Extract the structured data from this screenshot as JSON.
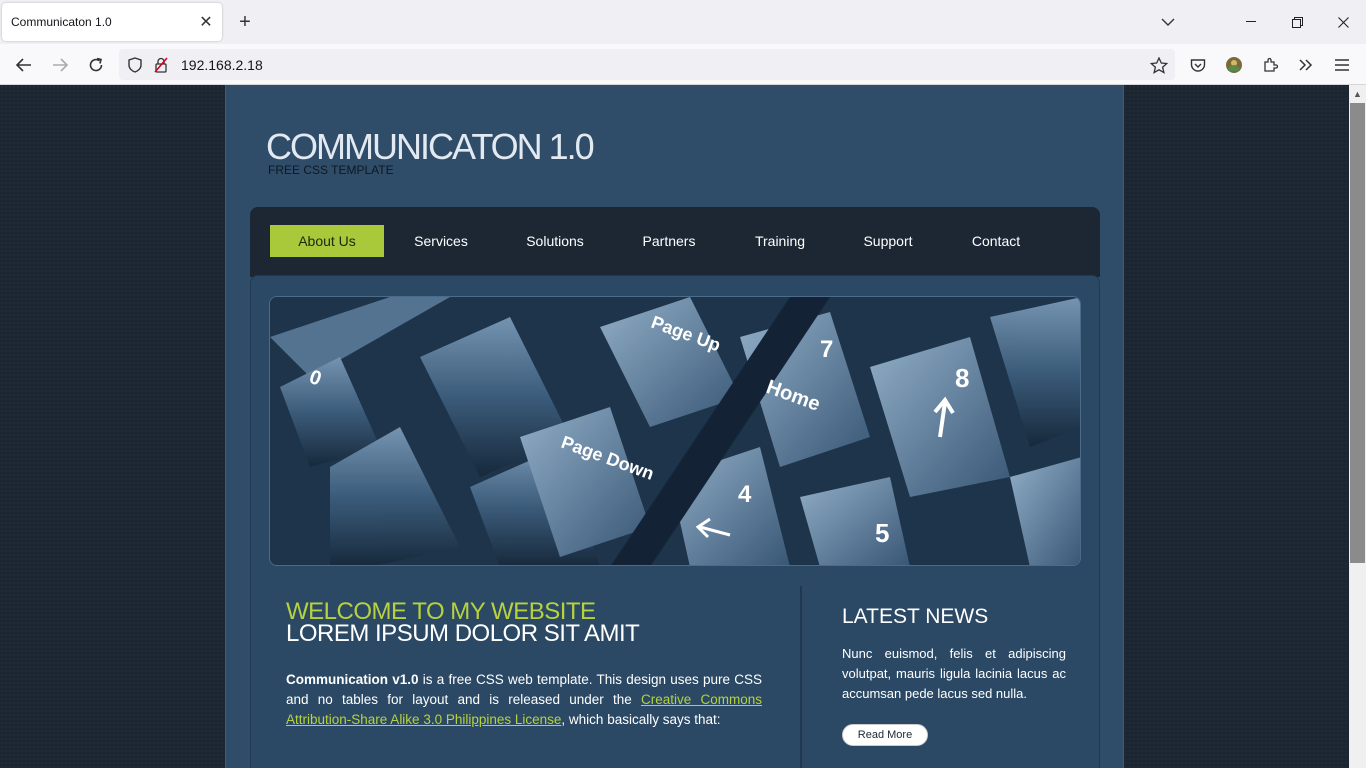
{
  "browser": {
    "tab_title": "Communicaton 1.0",
    "url": "192.168.2.18"
  },
  "site": {
    "logo": "COMMUNICATON 1.0",
    "tagline": "FREE CSS TEMPLATE",
    "menu": [
      {
        "label": "About Us",
        "active": true
      },
      {
        "label": "Services",
        "active": false
      },
      {
        "label": "Solutions",
        "active": false
      },
      {
        "label": "Partners",
        "active": false
      },
      {
        "label": "Training",
        "active": false
      },
      {
        "label": "Support",
        "active": false
      },
      {
        "label": "Contact",
        "active": false
      }
    ],
    "hero": {
      "keys": [
        "Page Up",
        "Page Down",
        "Home",
        "7",
        "8",
        "4",
        "5",
        "0"
      ]
    },
    "welcome": {
      "heading1": "WELCOME TO MY WEBSITE",
      "heading2": "LOREM IPSUM DOLOR SIT AMIT",
      "bold": "Communication v1.0",
      "text1": " is a free CSS web template. This design uses pure CSS and no tables for layout and is released under the ",
      "link": "Creative Commons Attribution-Share Alike 3.0 Philippines License",
      "text2": ", which basically says that:"
    },
    "news": {
      "title": "LATEST NEWS",
      "body": "Nunc euismod, felis et adipiscing volutpat, mauris ligula lacinia lacus ac accumsan pede lacus sed nulla.",
      "button": "Read More"
    }
  },
  "colors": {
    "accent": "#a9c83a",
    "page_bg": "#2f4d69",
    "menu_bg": "#1c2733"
  }
}
